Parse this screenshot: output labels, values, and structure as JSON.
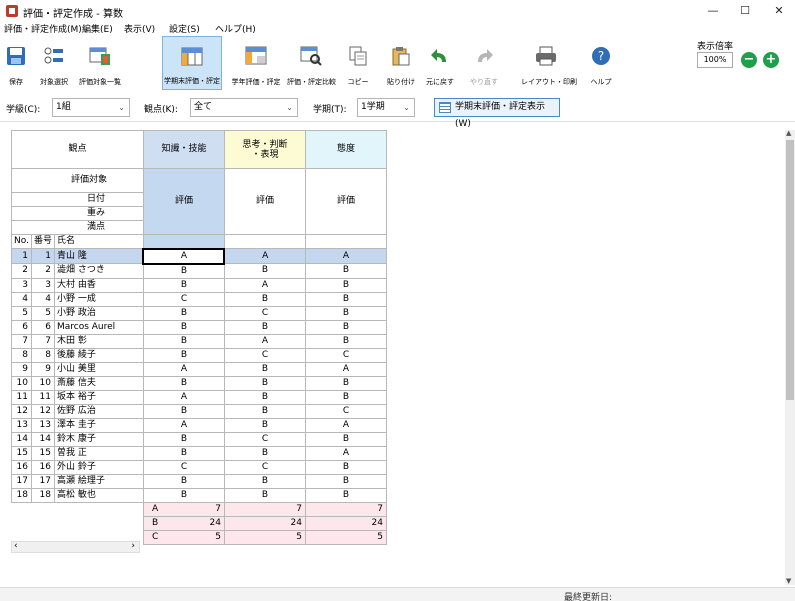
{
  "window": {
    "title": "評価・評定作成 - 算数",
    "minimize": "—",
    "maximize": "☐",
    "close": "✕"
  },
  "menu": [
    "評価・評定作成(M)",
    "編集(E)",
    "表示(V)",
    "設定(S)",
    "ヘルプ(H)"
  ],
  "toolbar": {
    "save": "保存",
    "target_select": "対象選択",
    "eval_list": "評価対象一覧",
    "term_end": "学期末評価・評定",
    "year_end": "学年評価・評定",
    "compare": "評価・評定比較",
    "copy": "コピー",
    "paste": "貼り付け",
    "undo": "元に戻す",
    "redo": "やり直す",
    "layout_print": "レイアウト・印刷",
    "help": "ヘルプ",
    "zoom_label": "表示倍率",
    "zoom_value": "100%",
    "zoom_minus": "−",
    "zoom_plus": "+"
  },
  "filters": {
    "class_label": "学級(C):",
    "class_value": "1組",
    "kanten_label": "観点(K):",
    "kanten_value": "全て",
    "term_label": "学期(T):",
    "term_value": "1学期",
    "show_button": "学期末評価・評定表示(W)"
  },
  "header": {
    "kanten": "観点",
    "target": "評価対象",
    "date": "日付",
    "weight": "重み",
    "full": "満点",
    "no": "No.",
    "num": "番号",
    "name": "氏名",
    "col1": "知識・技能",
    "col2_line1": "思考・判断",
    "col2_line2": "・表現",
    "col3": "態度",
    "eval": "評価"
  },
  "students": [
    {
      "no": "1",
      "num": "1",
      "name": "青山 隆",
      "a": "A",
      "b": "A",
      "c": "A"
    },
    {
      "no": "2",
      "num": "2",
      "name": "澁畑 さつき",
      "a": "B",
      "b": "B",
      "c": "B"
    },
    {
      "no": "3",
      "num": "3",
      "name": "大村 由香",
      "a": "B",
      "b": "A",
      "c": "B"
    },
    {
      "no": "4",
      "num": "4",
      "name": "小野 一成",
      "a": "C",
      "b": "B",
      "c": "B"
    },
    {
      "no": "5",
      "num": "5",
      "name": "小野 政治",
      "a": "B",
      "b": "C",
      "c": "B"
    },
    {
      "no": "6",
      "num": "6",
      "name": "Marcos Aurel",
      "a": "B",
      "b": "B",
      "c": "B"
    },
    {
      "no": "7",
      "num": "7",
      "name": "木田 彰",
      "a": "B",
      "b": "A",
      "c": "B"
    },
    {
      "no": "8",
      "num": "8",
      "name": "後藤 綾子",
      "a": "B",
      "b": "C",
      "c": "C"
    },
    {
      "no": "9",
      "num": "9",
      "name": "小山 美里",
      "a": "A",
      "b": "B",
      "c": "A"
    },
    {
      "no": "10",
      "num": "10",
      "name": "斎藤 信夫",
      "a": "B",
      "b": "B",
      "c": "B"
    },
    {
      "no": "11",
      "num": "11",
      "name": "坂本 裕子",
      "a": "A",
      "b": "B",
      "c": "B"
    },
    {
      "no": "12",
      "num": "12",
      "name": "佐野 広治",
      "a": "B",
      "b": "B",
      "c": "C"
    },
    {
      "no": "13",
      "num": "13",
      "name": "澤本 圭子",
      "a": "A",
      "b": "B",
      "c": "A"
    },
    {
      "no": "14",
      "num": "14",
      "name": "鈴木 康子",
      "a": "B",
      "b": "C",
      "c": "B"
    },
    {
      "no": "15",
      "num": "15",
      "name": "曽我 正",
      "a": "B",
      "b": "B",
      "c": "A"
    },
    {
      "no": "16",
      "num": "16",
      "name": "外山 鈴子",
      "a": "C",
      "b": "C",
      "c": "B"
    },
    {
      "no": "17",
      "num": "17",
      "name": "高瀬 絵理子",
      "a": "B",
      "b": "B",
      "c": "B"
    },
    {
      "no": "18",
      "num": "18",
      "name": "高松 敏也",
      "a": "B",
      "b": "B",
      "c": "B"
    }
  ],
  "summary": [
    {
      "grade": "A",
      "c1": "7",
      "c2": "7",
      "c3": "7"
    },
    {
      "grade": "B",
      "c1": "24",
      "c2": "24",
      "c3": "24"
    },
    {
      "grade": "C",
      "c1": "5",
      "c2": "5",
      "c3": "5"
    }
  ],
  "status": {
    "last_updated_label": "最終更新日:"
  },
  "colors": {
    "kc": "#d0def2",
    "hy": "#fdfbd3",
    "td": "#e2f5fa",
    "summary": "#fde6ec",
    "accent": "#1f9e4c"
  }
}
